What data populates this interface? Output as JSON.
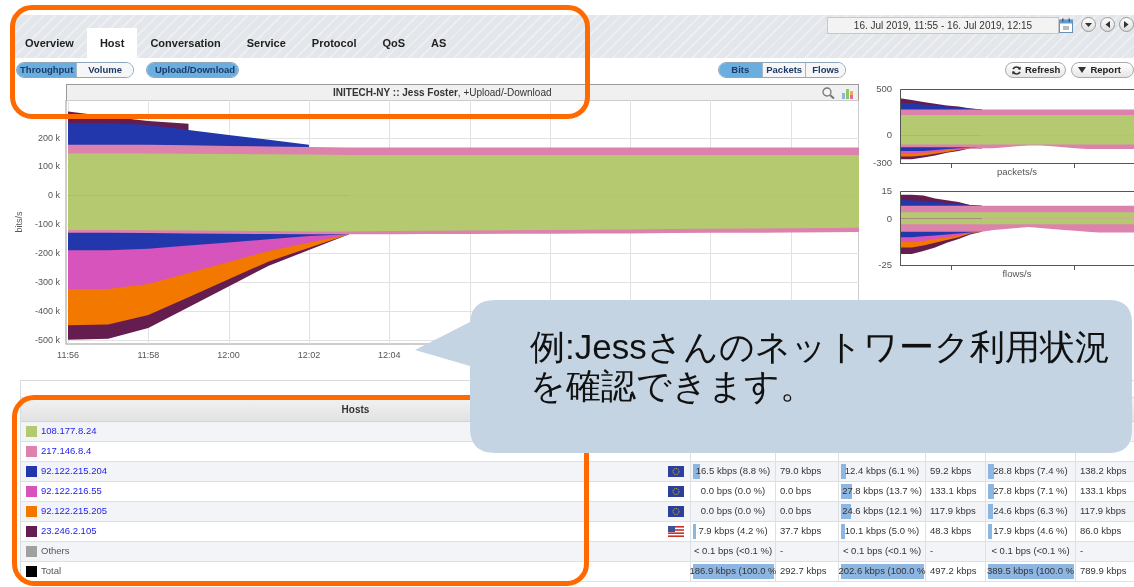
{
  "tabs": [
    {
      "label": "Overview",
      "selected": false
    },
    {
      "label": "Host",
      "selected": true
    },
    {
      "label": "Conversation",
      "selected": false
    },
    {
      "label": "Service",
      "selected": false
    },
    {
      "label": "Protocol",
      "selected": false
    },
    {
      "label": "QoS",
      "selected": false
    },
    {
      "label": "AS",
      "selected": false
    }
  ],
  "date_range": "16. Jul 2019, 11:55 - 16. Jul 2019, 12:15",
  "view_toggle": [
    {
      "label": "Throughput",
      "selected": true
    },
    {
      "label": "Volume",
      "selected": false
    }
  ],
  "direction_toggle": [
    {
      "label": "Upload/Download",
      "selected": true
    }
  ],
  "unit_toggle": [
    {
      "label": "Bits",
      "selected": true
    },
    {
      "label": "Packets",
      "selected": false
    },
    {
      "label": "Flows",
      "selected": false
    }
  ],
  "buttons": [
    {
      "label": "Refresh",
      "kind": "refresh"
    },
    {
      "label": "Report",
      "kind": "report"
    }
  ],
  "main_chart": {
    "title": "**INITECH-NY :: Jess Foster**, +Upload/-Download",
    "chart_data": {
      "type": "area",
      "stacked": false,
      "grid": true,
      "ylabel": "bits/s",
      "categories": [
        "11:56",
        null,
        "11:58",
        null,
        "12:00",
        null,
        "12:02",
        null,
        "12:04",
        null,
        null,
        null,
        null,
        null,
        null,
        null,
        null,
        null,
        null,
        null,
        null
      ],
      "ylim": [
        -515,
        330
      ],
      "yticks": [
        {
          "value": -500,
          "label": "-500 k"
        },
        {
          "value": -400,
          "label": "-400 k"
        },
        {
          "value": -300,
          "label": "-300 k"
        },
        {
          "value": -200,
          "label": "-200 k"
        },
        {
          "value": -100,
          "label": "-100 k"
        },
        {
          "value": 0,
          "label": "0 k"
        },
        {
          "value": 100,
          "label": "100 k"
        },
        {
          "value": 200,
          "label": "200 k"
        }
      ],
      "series": [
        {
          "color": "#651c4f",
          "values": [
            290,
            273,
            257,
            248,
            null,
            null,
            null,
            null,
            null,
            null,
            null,
            null,
            null,
            null,
            null,
            null,
            null,
            null,
            null,
            null,
            null
          ]
        },
        {
          "color": "#2337ad",
          "values": [
            250,
            250,
            243,
            226,
            209,
            192,
            175,
            null,
            null,
            null,
            null,
            null,
            null,
            null,
            null,
            null,
            null,
            null,
            null,
            null,
            null
          ]
        },
        {
          "color": "#dc82ad",
          "values": [
            175,
            175,
            175,
            173,
            171,
            169,
            167,
            165,
            165,
            165,
            165,
            165,
            165,
            165,
            165,
            165,
            165,
            165,
            165,
            165,
            165
          ]
        },
        {
          "color": "#b5c971",
          "values": [
            145,
            145,
            145,
            144,
            143,
            142,
            141,
            140,
            140,
            140,
            140,
            140,
            140,
            140,
            140,
            140,
            140,
            140,
            140,
            140,
            140
          ]
        },
        {
          "color": "#651c4f",
          "values": [
            -500,
            -497,
            -460,
            -388,
            -316,
            -244,
            null,
            -135,
            null,
            null,
            null,
            null,
            null,
            null,
            null,
            null,
            null,
            null,
            null,
            null,
            null
          ]
        },
        {
          "color": "#f27800",
          "values": [
            -450,
            -447,
            -415,
            -353,
            -291,
            -229,
            null,
            -135,
            null,
            null,
            null,
            null,
            null,
            null,
            null,
            null,
            null,
            null,
            null,
            null,
            null
          ]
        },
        {
          "color": "#d654bb",
          "values": [
            -325,
            -325,
            -307,
            -269,
            -231,
            -193,
            null,
            -135,
            null,
            null,
            null,
            null,
            null,
            null,
            null,
            null,
            null,
            null,
            null,
            null,
            null
          ]
        },
        {
          "color": "#2337ad",
          "values": [
            -190,
            -190,
            -185,
            -174,
            -163,
            -152,
            -141,
            -135,
            null,
            null,
            null,
            null,
            null,
            null,
            null,
            null,
            null,
            null,
            null,
            null,
            null
          ]
        },
        {
          "color": "#dc82ad",
          "values": [
            -130,
            -130,
            -131,
            -132,
            -133,
            -134,
            -135,
            -135,
            -135,
            -134,
            -134,
            -133,
            -133,
            -132,
            -132,
            -131,
            -130,
            -130,
            -129,
            -128,
            -127
          ]
        },
        {
          "color": "#b5c971",
          "values": [
            -120,
            -120,
            -121,
            -122,
            -123,
            -124,
            -125,
            -125,
            -124,
            -123,
            -122,
            -121,
            -120,
            -119,
            -118,
            -117,
            -116,
            -115,
            -114,
            -113,
            -112
          ]
        }
      ]
    }
  },
  "packets_chart": {
    "y_labels": [
      "500",
      "0",
      "-300"
    ],
    "xlabel": "packets/s"
  },
  "flows_chart": {
    "y_labels": [
      "15",
      "0",
      "-25"
    ],
    "xlabel": "flows/s"
  },
  "hosts_table": {
    "header": "Hosts",
    "rows": [
      {
        "name": "108.177.8.24",
        "kind": "host",
        "color": "#b5c971"
      },
      {
        "name": "217.146.8.4",
        "kind": "host",
        "color": "#dc82ad"
      },
      {
        "name": "92.122.215.204",
        "kind": "host",
        "color": "#2337ad",
        "flag": {
          "kind": "eu"
        },
        "cells": [
          {
            "kind": "bar",
            "text": "16.5 kbps (8.8 %)",
            "level": 0.088
          },
          {
            "kind": "plain",
            "text": "79.0 kbps"
          },
          {
            "kind": "bar",
            "text": "12.4 kbps (6.1 %)",
            "level": 0.061
          },
          {
            "kind": "plain",
            "text": "59.2 kbps"
          },
          {
            "kind": "bar",
            "text": "28.8 kbps (7.4 %)",
            "level": 0.074
          },
          {
            "kind": "plain",
            "text": "138.2 kbps"
          }
        ]
      },
      {
        "name": "92.122.216.55",
        "kind": "host",
        "color": "#d654bb",
        "flag": {
          "kind": "eu"
        },
        "cells": [
          {
            "kind": "bar",
            "text": "0.0 bps (0.0 %)"
          },
          {
            "kind": "plain",
            "text": "0.0 bps"
          },
          {
            "kind": "bar",
            "text": "27.8 kbps (13.7 %)",
            "level": 0.137
          },
          {
            "kind": "plain",
            "text": "133.1 kbps"
          },
          {
            "kind": "bar",
            "text": "27.8 kbps (7.1 %)",
            "level": 0.071
          },
          {
            "kind": "plain",
            "text": "133.1 kbps"
          }
        ]
      },
      {
        "name": "92.122.215.205",
        "kind": "host",
        "color": "#f27800",
        "flag": {
          "kind": "eu"
        },
        "cells": [
          {
            "kind": "bar",
            "text": "0.0 bps (0.0 %)"
          },
          {
            "kind": "plain",
            "text": "0.0 bps"
          },
          {
            "kind": "bar",
            "text": "24.6 kbps (12.1 %)",
            "level": 0.121
          },
          {
            "kind": "plain",
            "text": "117.9 kbps"
          },
          {
            "kind": "bar",
            "text": "24.6 kbps (6.3 %)",
            "level": 0.063
          },
          {
            "kind": "plain",
            "text": "117.9 kbps"
          }
        ]
      },
      {
        "name": "23.246.2.105",
        "kind": "host",
        "color": "#651c4f",
        "flag": {
          "kind": "us"
        },
        "cells": [
          {
            "kind": "bar",
            "text": "7.9 kbps (4.2 %)",
            "level": 0.042
          },
          {
            "kind": "plain",
            "text": "37.7 kbps"
          },
          {
            "kind": "bar",
            "text": "10.1 kbps (5.0 %)",
            "level": 0.05
          },
          {
            "kind": "plain",
            "text": "48.3 kbps"
          },
          {
            "kind": "bar",
            "text": "17.9 kbps (4.6 %)",
            "level": 0.046
          },
          {
            "kind": "plain",
            "text": "86.0 kbps"
          }
        ]
      },
      {
        "name": "Others",
        "kind": "other",
        "color": "#a0a0a0",
        "cells": [
          {
            "kind": "bar",
            "text": "< 0.1 bps (<0.1 %)"
          },
          {
            "kind": "plain",
            "text": "-"
          },
          {
            "kind": "bar",
            "text": "< 0.1 bps (<0.1 %)"
          },
          {
            "kind": "plain",
            "text": "-"
          },
          {
            "kind": "bar",
            "text": "< 0.1 bps (<0.1 %)"
          },
          {
            "kind": "plain",
            "text": "-"
          }
        ]
      },
      {
        "name": "Total",
        "kind": "total",
        "color": "#000000",
        "cells": [
          {
            "kind": "bar",
            "text": "186.9 kbps (100.0 %",
            "level": 1
          },
          {
            "kind": "plain",
            "text": "292.7 kbps"
          },
          {
            "kind": "bar",
            "text": "202.6 kbps (100.0 %",
            "level": 1
          },
          {
            "kind": "plain",
            "text": "497.2 kbps"
          },
          {
            "kind": "bar",
            "text": "389.5 kbps (100.0 %",
            "level": 1
          },
          {
            "kind": "plain",
            "text": "789.9 kbps"
          }
        ]
      }
    ]
  },
  "callout": {
    "text": "例:Jessさんのネットワーク利用状況を確認できます。"
  }
}
